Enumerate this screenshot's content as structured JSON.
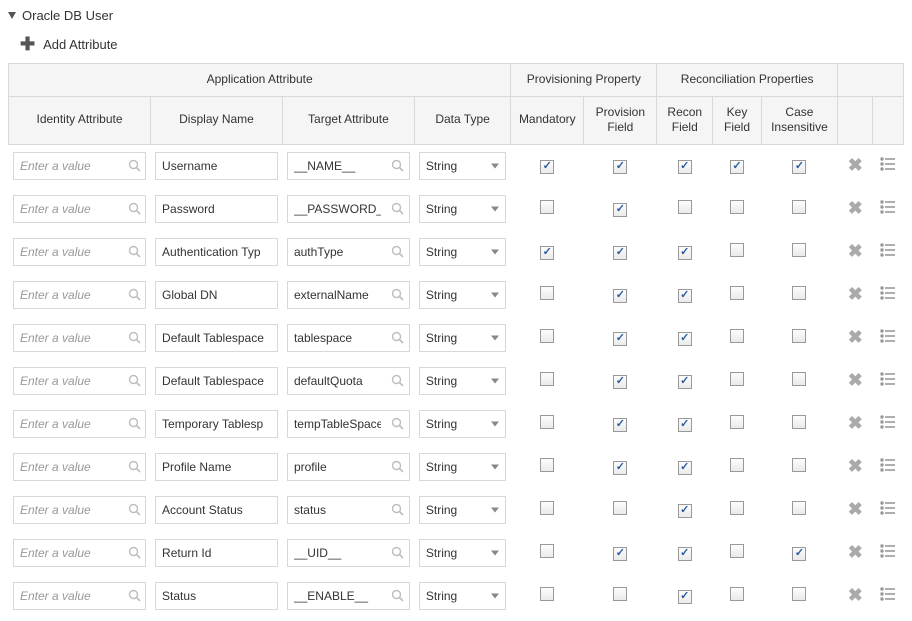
{
  "section": {
    "title": "Oracle DB User"
  },
  "actions": {
    "add_label": "Add Attribute"
  },
  "headers": {
    "group_app": "Application Attribute",
    "group_prov": "Provisioning Property",
    "group_recon": "Reconciliation Properties",
    "identity": "Identity Attribute",
    "display": "Display Name",
    "target": "Target Attribute",
    "datatype": "Data Type",
    "mandatory": "Mandatory",
    "provfield": "Provision Field",
    "reconfield": "Recon Field",
    "keyfield": "Key Field",
    "caseins": "Case Insensitive"
  },
  "placeholders": {
    "identity": "Enter a value"
  },
  "rows": [
    {
      "identity": "",
      "display": "Username",
      "target": "__NAME__",
      "datatype": "String",
      "mandatory": true,
      "provfield": true,
      "reconfield": true,
      "keyfield": true,
      "caseins": true
    },
    {
      "identity": "",
      "display": "Password",
      "target": "__PASSWORD__",
      "datatype": "String",
      "mandatory": false,
      "provfield": true,
      "reconfield": false,
      "keyfield": false,
      "caseins": false
    },
    {
      "identity": "",
      "display": "Authentication Typ",
      "target": "authType",
      "datatype": "String",
      "mandatory": true,
      "provfield": true,
      "reconfield": true,
      "keyfield": false,
      "caseins": false
    },
    {
      "identity": "",
      "display": "Global DN",
      "target": "externalName",
      "datatype": "String",
      "mandatory": false,
      "provfield": true,
      "reconfield": true,
      "keyfield": false,
      "caseins": false
    },
    {
      "identity": "",
      "display": "Default Tablespace",
      "target": "tablespace",
      "datatype": "String",
      "mandatory": false,
      "provfield": true,
      "reconfield": true,
      "keyfield": false,
      "caseins": false
    },
    {
      "identity": "",
      "display": "Default Tablespace",
      "target": "defaultQuota",
      "datatype": "String",
      "mandatory": false,
      "provfield": true,
      "reconfield": true,
      "keyfield": false,
      "caseins": false
    },
    {
      "identity": "",
      "display": "Temporary Tablesp",
      "target": "tempTableSpace",
      "datatype": "String",
      "mandatory": false,
      "provfield": true,
      "reconfield": true,
      "keyfield": false,
      "caseins": false
    },
    {
      "identity": "",
      "display": "Profile Name",
      "target": "profile",
      "datatype": "String",
      "mandatory": false,
      "provfield": true,
      "reconfield": true,
      "keyfield": false,
      "caseins": false
    },
    {
      "identity": "",
      "display": "Account Status",
      "target": "status",
      "datatype": "String",
      "mandatory": false,
      "provfield": false,
      "reconfield": true,
      "keyfield": false,
      "caseins": false
    },
    {
      "identity": "",
      "display": "Return Id",
      "target": "__UID__",
      "datatype": "String",
      "mandatory": false,
      "provfield": true,
      "reconfield": true,
      "keyfield": false,
      "caseins": true
    },
    {
      "identity": "",
      "display": "Status",
      "target": "__ENABLE__",
      "datatype": "String",
      "mandatory": false,
      "provfield": false,
      "reconfield": true,
      "keyfield": false,
      "caseins": false
    }
  ]
}
